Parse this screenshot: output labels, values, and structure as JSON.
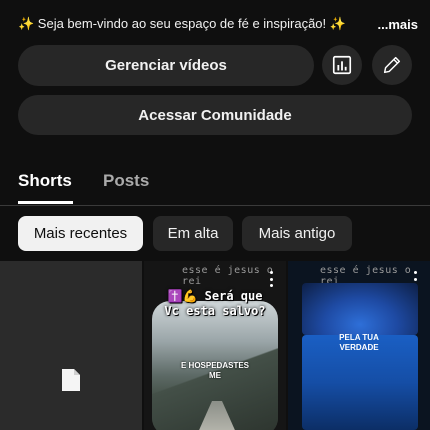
{
  "header": {
    "description": "✨ Seja bem-vindo ao seu espaço de fé e inspiração! ✨",
    "more_label": "...mais"
  },
  "actions": {
    "manage_videos": "Gerenciar vídeos",
    "community": "Acessar Comunidade",
    "analytics_icon": "analytics-icon",
    "edit_icon": "pencil-icon"
  },
  "tabs": [
    {
      "label": "Shorts",
      "active": true
    },
    {
      "label": "Posts",
      "active": false
    }
  ],
  "filters": [
    {
      "label": "Mais recentes",
      "active": true
    },
    {
      "label": "Em alta",
      "active": false
    },
    {
      "label": "Mais antigo",
      "active": false
    }
  ],
  "shorts": [
    {
      "type": "placeholder",
      "icon": "file-icon"
    },
    {
      "handle": "esse é jesus o rei",
      "title_emoji": "✝️💪",
      "title_line1": "Será que",
      "title_line2": "Vc esta salvo?",
      "caption_line1": "E HOSPEDASTES",
      "caption_line2": "ME"
    },
    {
      "handle": "esse é jesus o rei",
      "caption_line1": "PELA TUA",
      "caption_line2": "VERDADE"
    }
  ],
  "colors": {
    "background": "#0f0f0f",
    "surface": "#272727",
    "active_chip": "#f1f1f1",
    "muted_text": "#aaaaaa"
  }
}
